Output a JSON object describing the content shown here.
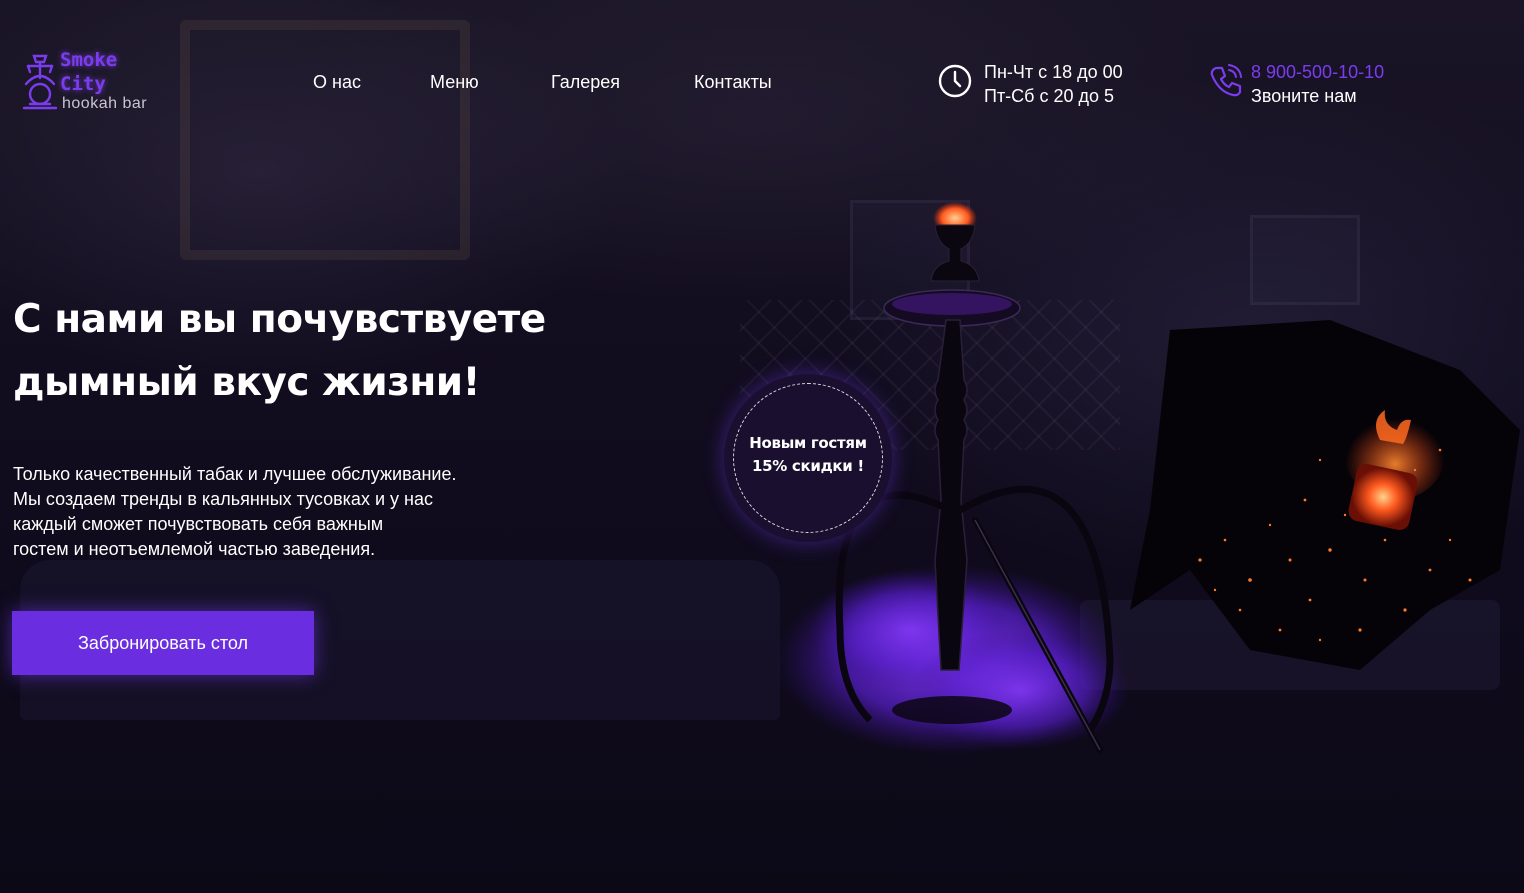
{
  "brand": {
    "name_line1": "Smoke",
    "name_line2": "City",
    "tagline": "hookah bar",
    "accent_color": "#7b3cf0"
  },
  "nav": {
    "items": [
      {
        "label": "О нас"
      },
      {
        "label": "Меню"
      },
      {
        "label": "Галерея"
      },
      {
        "label": "Контакты"
      }
    ]
  },
  "hours": {
    "icon": "clock-icon",
    "line1": "Пн-Чт с 18 до 00",
    "line2": "Пт-Сб с 20 до 5"
  },
  "contact": {
    "icon": "phone-icon",
    "phone": "8 900-500-10-10",
    "caption": "Звоните нам"
  },
  "hero": {
    "title_line1": "С нами вы почувствуете",
    "title_line2": "дымный вкус жизни!",
    "text_lines": [
      "Только качественный табак и лучшее обслуживание.",
      "Мы создаем тренды в кальянных тусовках и у нас",
      "каждый сможет почувствовать себя важным",
      "гостем и неотъемлемой частью заведения."
    ],
    "cta_label": "Забронировать стол",
    "cta_color": "#6a2ee0"
  },
  "promo_badge": {
    "line1": "Новым гостям",
    "line2": "15% скидки !"
  },
  "images": {
    "hookah": "hookah-image",
    "coal": "burning-coal-image"
  }
}
